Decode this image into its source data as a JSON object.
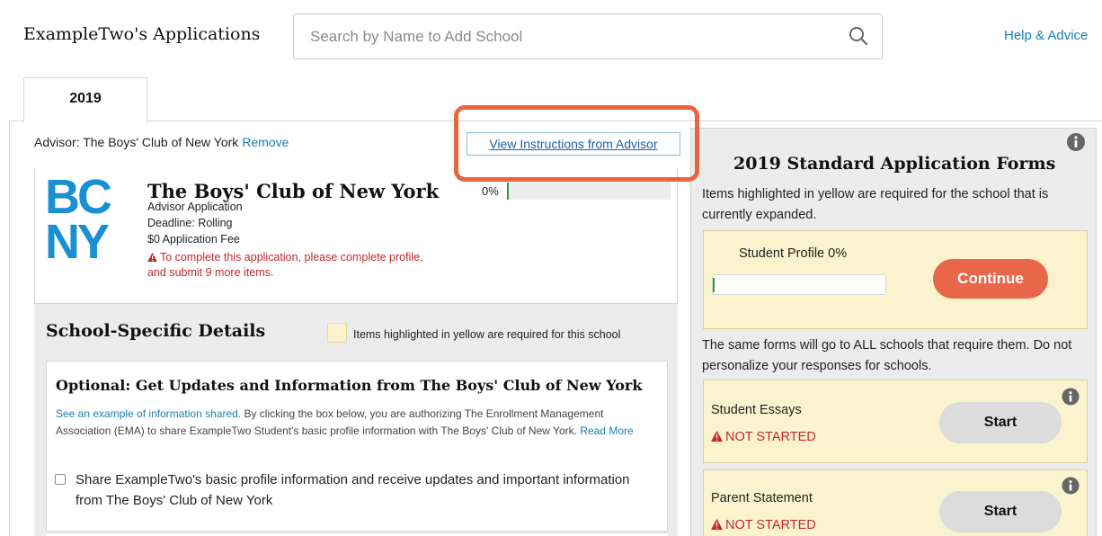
{
  "header": {
    "title": "ExampleTwo's Applications",
    "search_placeholder": "Search by Name to Add School",
    "help_link": "Help & Advice"
  },
  "tabs": [
    {
      "label": "2019",
      "selected": true
    }
  ],
  "advisor": {
    "label": "Advisor: The Boys' Club of New York",
    "remove_link": "Remove",
    "instructions_link": "View Instructions from Advisor"
  },
  "school": {
    "logo_top": "BC",
    "logo_bottom": "NY",
    "name": "The Boys' Club of New York",
    "type": "Advisor Application",
    "deadline": "Deadline: Rolling",
    "fee": "$0 Application Fee",
    "warning": "To complete this application, please complete profile, and submit 9 more items.",
    "progress_label": "0%",
    "progress_value": 0
  },
  "details": {
    "title": "School-Specific Details",
    "yellow_note": "Items highlighted in yellow are required for this school",
    "optional_title": "Optional: Get Updates and Information from The Boys' Club of New York",
    "example_link": "See an example of information shared.",
    "authorization_text": " By clicking the box below, you are authorizing The Enrollment Management Association (EMA) to share ExampleTwo Student's basic profile information with The Boys' Club of New York. ",
    "read_more": "Read More",
    "checkbox_label": "Share ExampleTwo's basic profile information and receive updates and important information from The Boys' Club of New York",
    "checkbox_checked": false
  },
  "forms": {
    "title": "2019 Standard Application Forms",
    "subtitle": "Items highlighted in yellow are required for the school that is currently expanded.",
    "profile_label": "Student Profile 0%",
    "profile_progress": 0,
    "continue_label": "Continue",
    "note": "The same forms will go to ALL schools that require them. Do not personalize your responses for schools.",
    "items": [
      {
        "name": "Student Essays",
        "status": "NOT STARTED",
        "action": "Start"
      },
      {
        "name": "Parent Statement",
        "status": "NOT STARTED",
        "action": "Start"
      }
    ]
  },
  "colors": {
    "accent_orange": "#e8663f",
    "link_blue": "#1b7fb3",
    "logo_blue": "#1a8fd1",
    "required_yellow": "#fbf3cd",
    "warning_red": "#c4282c",
    "progress_green": "#2e9b44"
  },
  "icons": {
    "search": "search-icon",
    "info": "info-icon",
    "warning": "warning-triangle-icon"
  }
}
